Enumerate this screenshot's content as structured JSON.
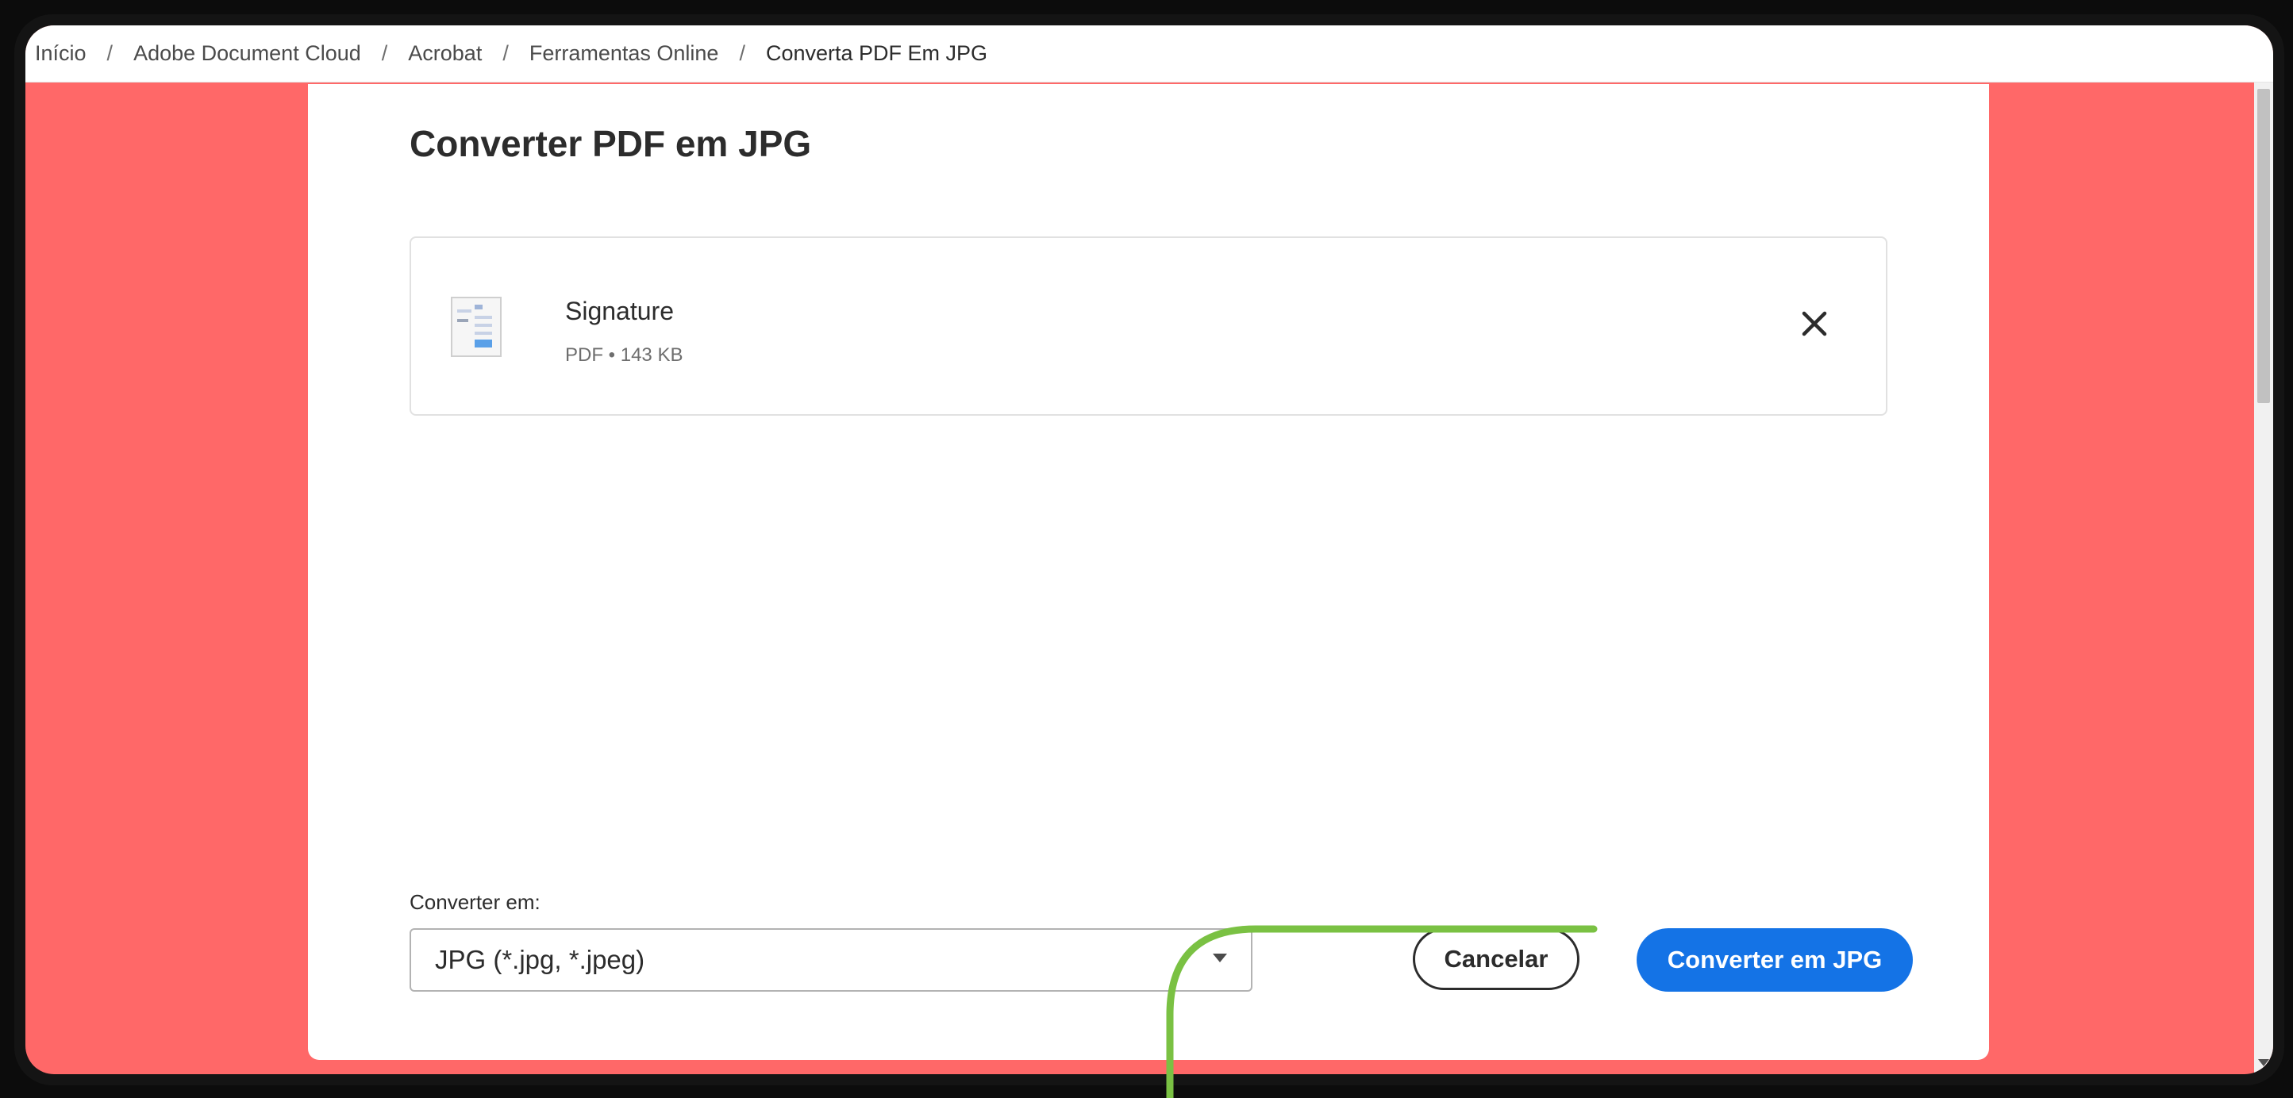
{
  "breadcrumb": {
    "items": [
      "Início",
      "Adobe Document Cloud",
      "Acrobat",
      "Ferramentas Online",
      "Converta PDF Em JPG"
    ],
    "separator": "/"
  },
  "page": {
    "title": "Converter PDF em JPG"
  },
  "file": {
    "name": "Signature",
    "meta": "PDF • 143 KB",
    "icon": "pdf-thumbnail-icon"
  },
  "convert": {
    "label": "Converter em:",
    "selected": "JPG (*.jpg, *.jpeg)"
  },
  "actions": {
    "cancel_label": "Cancelar",
    "convert_label": "Converter em JPG"
  },
  "colors": {
    "background": "#ff6868",
    "primary": "#1473e6",
    "annotation": "#7ac143"
  }
}
